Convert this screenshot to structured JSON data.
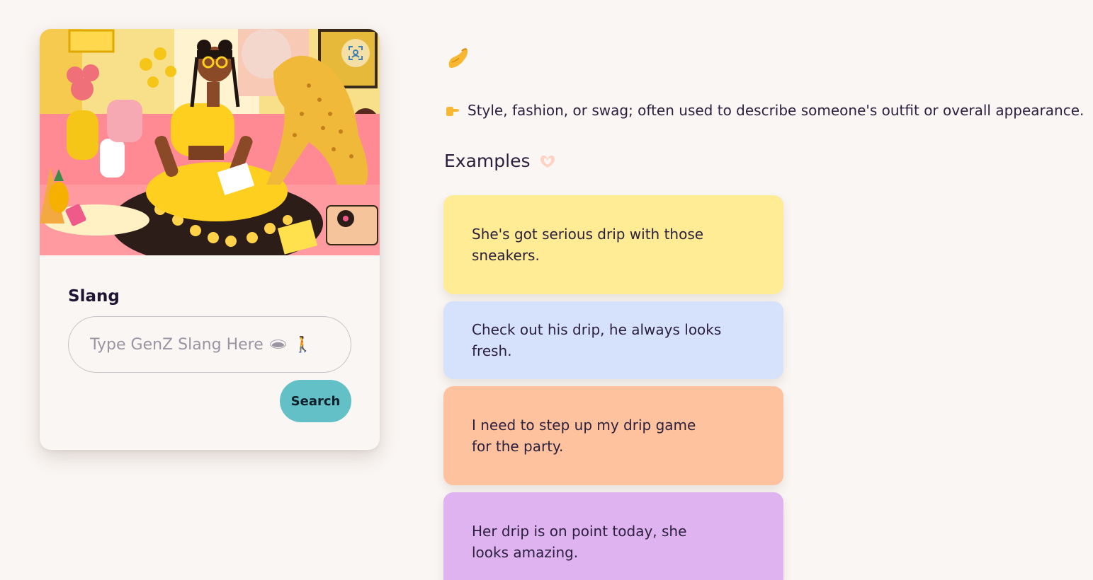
{
  "search_card": {
    "field_label": "Slang",
    "input_placeholder": "Type GenZ Slang Here 🕳 🚶",
    "input_value": "",
    "search_button_label": "Search"
  },
  "result": {
    "definition_emoji": "👉",
    "definition": "Style, fashion, or swag; often used to describe someone's outfit or overall appearance.",
    "examples_heading": "Examples",
    "examples": [
      {
        "text": "She's got serious drip with those sneakers.",
        "color": "#ffec94"
      },
      {
        "text": "Check out his drip, he always looks fresh.",
        "color": "#d6e2fb"
      },
      {
        "text": "I need to step up my drip game for the party.",
        "color": "#ffc29e"
      },
      {
        "text": "Her drip is on point today, she looks amazing.",
        "color": "#dfb2f0"
      }
    ]
  },
  "icons": {
    "top_emoji": "pinching-hand-icon",
    "definition_pointer": "pointing-right-icon",
    "examples_heart": "heart-hands-icon",
    "scan": "scan-icon"
  }
}
